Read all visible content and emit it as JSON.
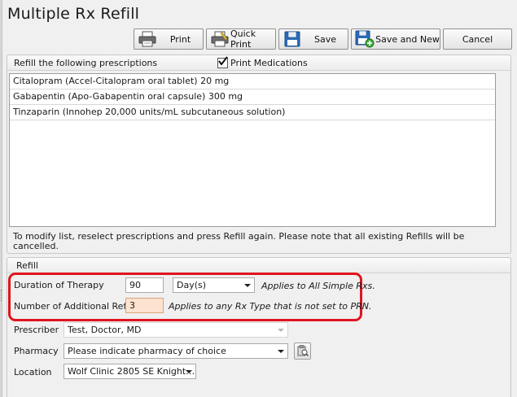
{
  "window": {
    "title": "Multiple Rx Refill"
  },
  "toolbar": {
    "print_label": "Print",
    "quick_print_label": "Quick Print",
    "save_label": "Save",
    "save_and_new_label": "Save and New",
    "cancel_label": "Cancel"
  },
  "prescriptions_panel": {
    "heading": "Refill the following prescriptions",
    "print_medications_label": "Print Medications",
    "print_medications_checked": true,
    "items": [
      {
        "label": "Citalopram (Accel-Citalopram oral tablet) 20 mg"
      },
      {
        "label": "Gabapentin (Apo-Gabapentin oral capsule) 300 mg"
      },
      {
        "label": "Tinzaparin (Innohep 20,000 units/mL subcutaneous solution)"
      }
    ],
    "note_line1": "To modify list, reselect prescriptions and press Refill again. Please note that all existing Refills will be",
    "note_line2": "cancelled."
  },
  "refill_panel": {
    "heading": "Refill",
    "duration": {
      "label": "Duration of Therapy",
      "value": "90",
      "unit": "Day(s)",
      "hint": "Applies to All Simple Rxs."
    },
    "refills": {
      "label": "Number of Additional Refills",
      "value": "3",
      "hint": "Applies to any Rx Type that is not set to PRN."
    },
    "prescriber": {
      "label": "Prescriber",
      "value": "Test, Doctor, MD"
    },
    "pharmacy": {
      "label": "Pharmacy",
      "value": "Please indicate pharmacy of choice"
    },
    "location": {
      "label": "Location",
      "value": "Wolf Clinic 2805 SE Knight…"
    }
  },
  "icons": {
    "print": "printer-icon",
    "quick_print": "quick-print-icon",
    "save": "floppy-disk-icon",
    "save_and_new": "save-and-new-icon",
    "pharmacy_lookup": "pharmacy-lookup-icon"
  },
  "colors": {
    "highlight": "#e0141e",
    "refill_input_bg": "#fde2cf"
  }
}
